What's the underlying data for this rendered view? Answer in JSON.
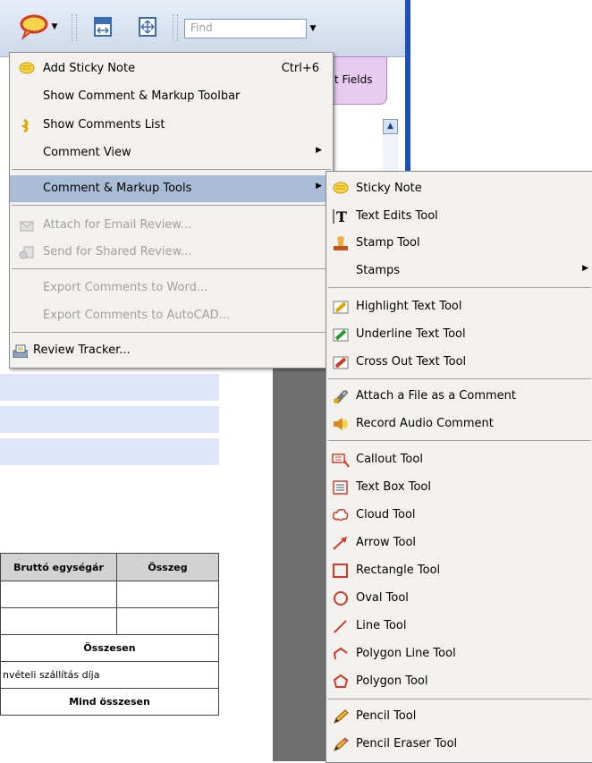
{
  "toolbar": {
    "find_placeholder": "Find"
  },
  "document": {
    "tab_fields": "t Fields"
  },
  "invoice": {
    "headers": [
      "Bruttó egységár",
      "Összeg"
    ],
    "total_label": "Összesen",
    "shipping_label": "nvételi szállítás díja",
    "grand_total_label": "Mind összesen"
  },
  "menu": {
    "add_sticky_note": "Add Sticky Note",
    "add_sticky_note_shortcut": "Ctrl+6",
    "show_toolbar": "Show Comment & Markup Toolbar",
    "show_comments_list": "Show Comments List",
    "comment_view": "Comment View",
    "markup_tools": "Comment & Markup Tools",
    "attach_email_review": "Attach for Email Review...",
    "send_shared_review": "Send for Shared Review...",
    "export_word": "Export Comments to Word...",
    "export_autocad": "Export Comments to AutoCAD...",
    "review_tracker": "Review Tracker..."
  },
  "submenu": {
    "sticky_note": "Sticky Note",
    "text_edits": "Text Edits Tool",
    "stamp_tool": "Stamp Tool",
    "stamps": "Stamps",
    "highlight": "Highlight Text Tool",
    "underline": "Underline Text Tool",
    "cross_out": "Cross Out Text Tool",
    "attach_file": "Attach a File as a Comment",
    "record_audio": "Record Audio Comment",
    "callout": "Callout Tool",
    "text_box": "Text Box Tool",
    "cloud": "Cloud Tool",
    "arrow": "Arrow Tool",
    "rectangle": "Rectangle Tool",
    "oval": "Oval Tool",
    "line": "Line Tool",
    "polygon_line": "Polygon Line Tool",
    "polygon": "Polygon Tool",
    "pencil": "Pencil Tool",
    "pencil_eraser": "Pencil Eraser Tool"
  },
  "colors": {
    "menu_bg": "#f2f1ee",
    "selected_item": "#a9bed6",
    "disabled_text": "#a0a0a0",
    "toolbar_edge": "#1a4fc4"
  }
}
